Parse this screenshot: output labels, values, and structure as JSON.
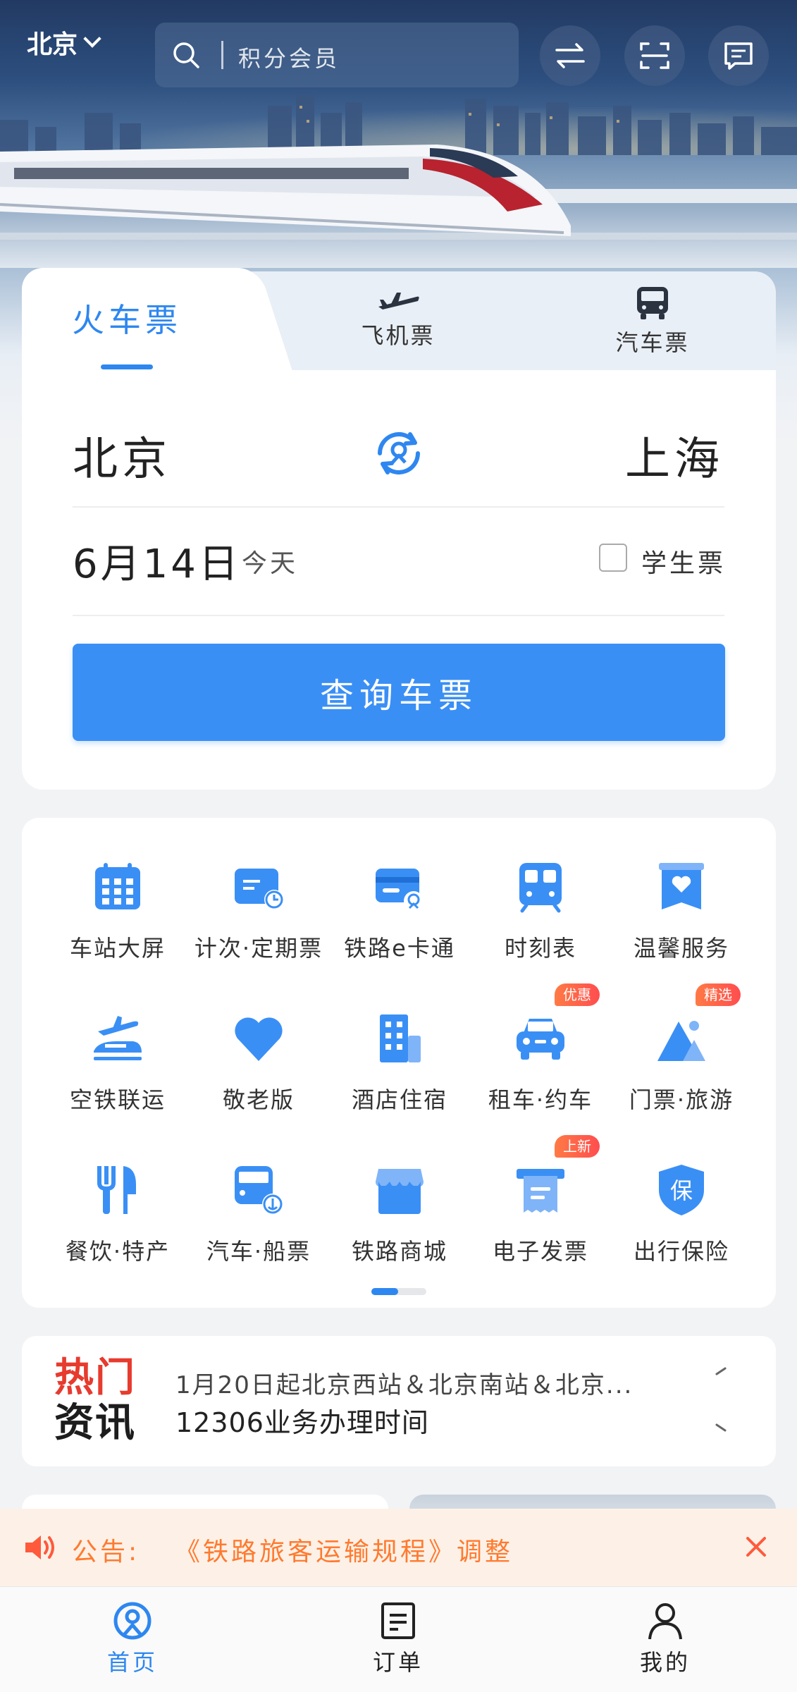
{
  "header": {
    "city": "北京",
    "search_placeholder": "积分会员"
  },
  "ticket_tabs": [
    {
      "label": "火车票",
      "active": true
    },
    {
      "label": "飞机票",
      "active": false
    },
    {
      "label": "汽车票",
      "active": false
    }
  ],
  "booking": {
    "from": "北京",
    "to": "上海",
    "date": "6月14日",
    "date_note": "今天",
    "student_ticket_label": "学生票",
    "student_ticket_checked": false,
    "query_button": "查询车票"
  },
  "services": [
    {
      "label": "车站大屏",
      "icon": "calendar-grid-icon"
    },
    {
      "label": "计次·定期票",
      "icon": "ticket-clock-icon"
    },
    {
      "label": "铁路e卡通",
      "icon": "railway-card-icon"
    },
    {
      "label": "时刻表",
      "icon": "train-front-icon"
    },
    {
      "label": "温馨服务",
      "icon": "heart-box-icon"
    },
    {
      "label": "空铁联运",
      "icon": "plane-train-icon"
    },
    {
      "label": "敬老版",
      "icon": "heart-icon"
    },
    {
      "label": "酒店住宿",
      "icon": "hotel-icon"
    },
    {
      "label": "租车·约车",
      "icon": "car-icon",
      "badge": "优惠"
    },
    {
      "label": "门票·旅游",
      "icon": "mountain-icon",
      "badge": "精选"
    },
    {
      "label": "餐饮·特产",
      "icon": "fork-knife-icon"
    },
    {
      "label": "汽车·船票",
      "icon": "bus-anchor-icon"
    },
    {
      "label": "铁路商城",
      "icon": "store-icon"
    },
    {
      "label": "电子发票",
      "icon": "invoice-icon",
      "badge": "上新"
    },
    {
      "label": "出行保险",
      "icon": "shield-insurance-icon",
      "badge_text_on_icon": "保"
    }
  ],
  "news": {
    "title_line1": "热门",
    "title_line2": "资讯",
    "line1": "1月20日起北京西站＆北京南站＆北京...",
    "line2": "12306业务办理时间"
  },
  "notice": {
    "prefix": "公告:",
    "text": "《铁路旅客运输规程》调整"
  },
  "bottom_nav": [
    {
      "label": "首页",
      "active": true
    },
    {
      "label": "订单",
      "active": false
    },
    {
      "label": "我的",
      "active": false
    }
  ],
  "colors": {
    "accent": "#2e87f0",
    "button": "#3a8ff5",
    "notice_text": "#ff7a2f",
    "notice_bg": "#fdf1e7",
    "badge": "#ff5a3c"
  }
}
